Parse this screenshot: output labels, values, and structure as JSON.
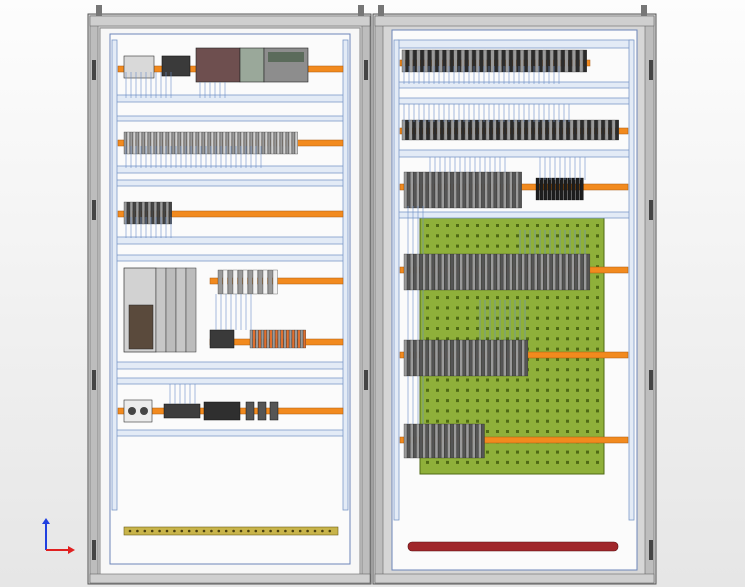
{
  "viewport": {
    "title": ""
  },
  "colors": {
    "background": "#f2f2f2",
    "frame": "#9a9a9a",
    "frame_dark": "#555555",
    "rail_orange": "#f28a1e",
    "duct_blue": "#7b99c9",
    "mounting_plate": "#8fb03a",
    "busbar_red": "#a0262a",
    "terminal_gray": "#c9c9c9",
    "module_dark": "#2f2f2f",
    "axis_x": "#e02020",
    "axis_z": "#2040e0"
  },
  "cabinets": [
    {
      "id": "left",
      "name": "left-cabinet"
    },
    {
      "id": "right",
      "name": "right-cabinet"
    }
  ],
  "axes": {
    "x_label": "",
    "z_label": ""
  }
}
